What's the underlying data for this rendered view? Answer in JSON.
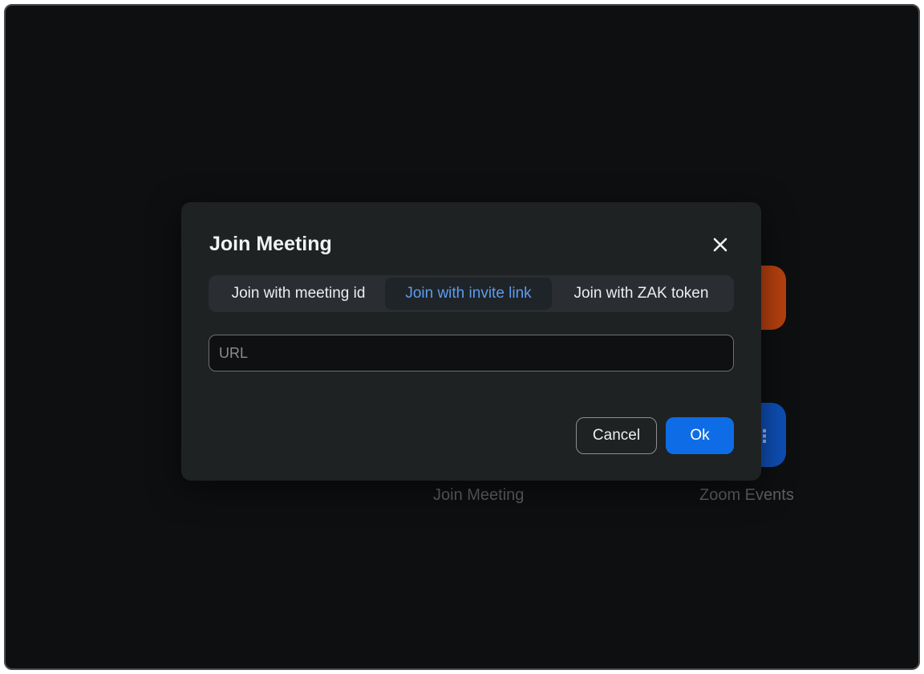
{
  "background": {
    "tiles": [
      {
        "name": "join-meeting",
        "label": "Join Meeting",
        "color": "#0e6de6"
      },
      {
        "name": "zoom-events",
        "label": "Zoom Events",
        "color": "#0e4fb5"
      }
    ],
    "orange_tile_color": "#b8410f"
  },
  "modal": {
    "title": "Join Meeting",
    "close_icon": "close-icon",
    "tabs": [
      {
        "label": "Join with meeting id",
        "active": false
      },
      {
        "label": "Join with invite link",
        "active": true
      },
      {
        "label": "Join with ZAK token",
        "active": false
      }
    ],
    "url_input": {
      "value": "",
      "placeholder": "URL"
    },
    "cancel_label": "Cancel",
    "ok_label": "Ok"
  },
  "colors": {
    "accent": "#0e6de6",
    "active_tab_text": "#5b9cf0",
    "modal_bg": "#1f2223",
    "window_bg": "#0e0f10"
  }
}
